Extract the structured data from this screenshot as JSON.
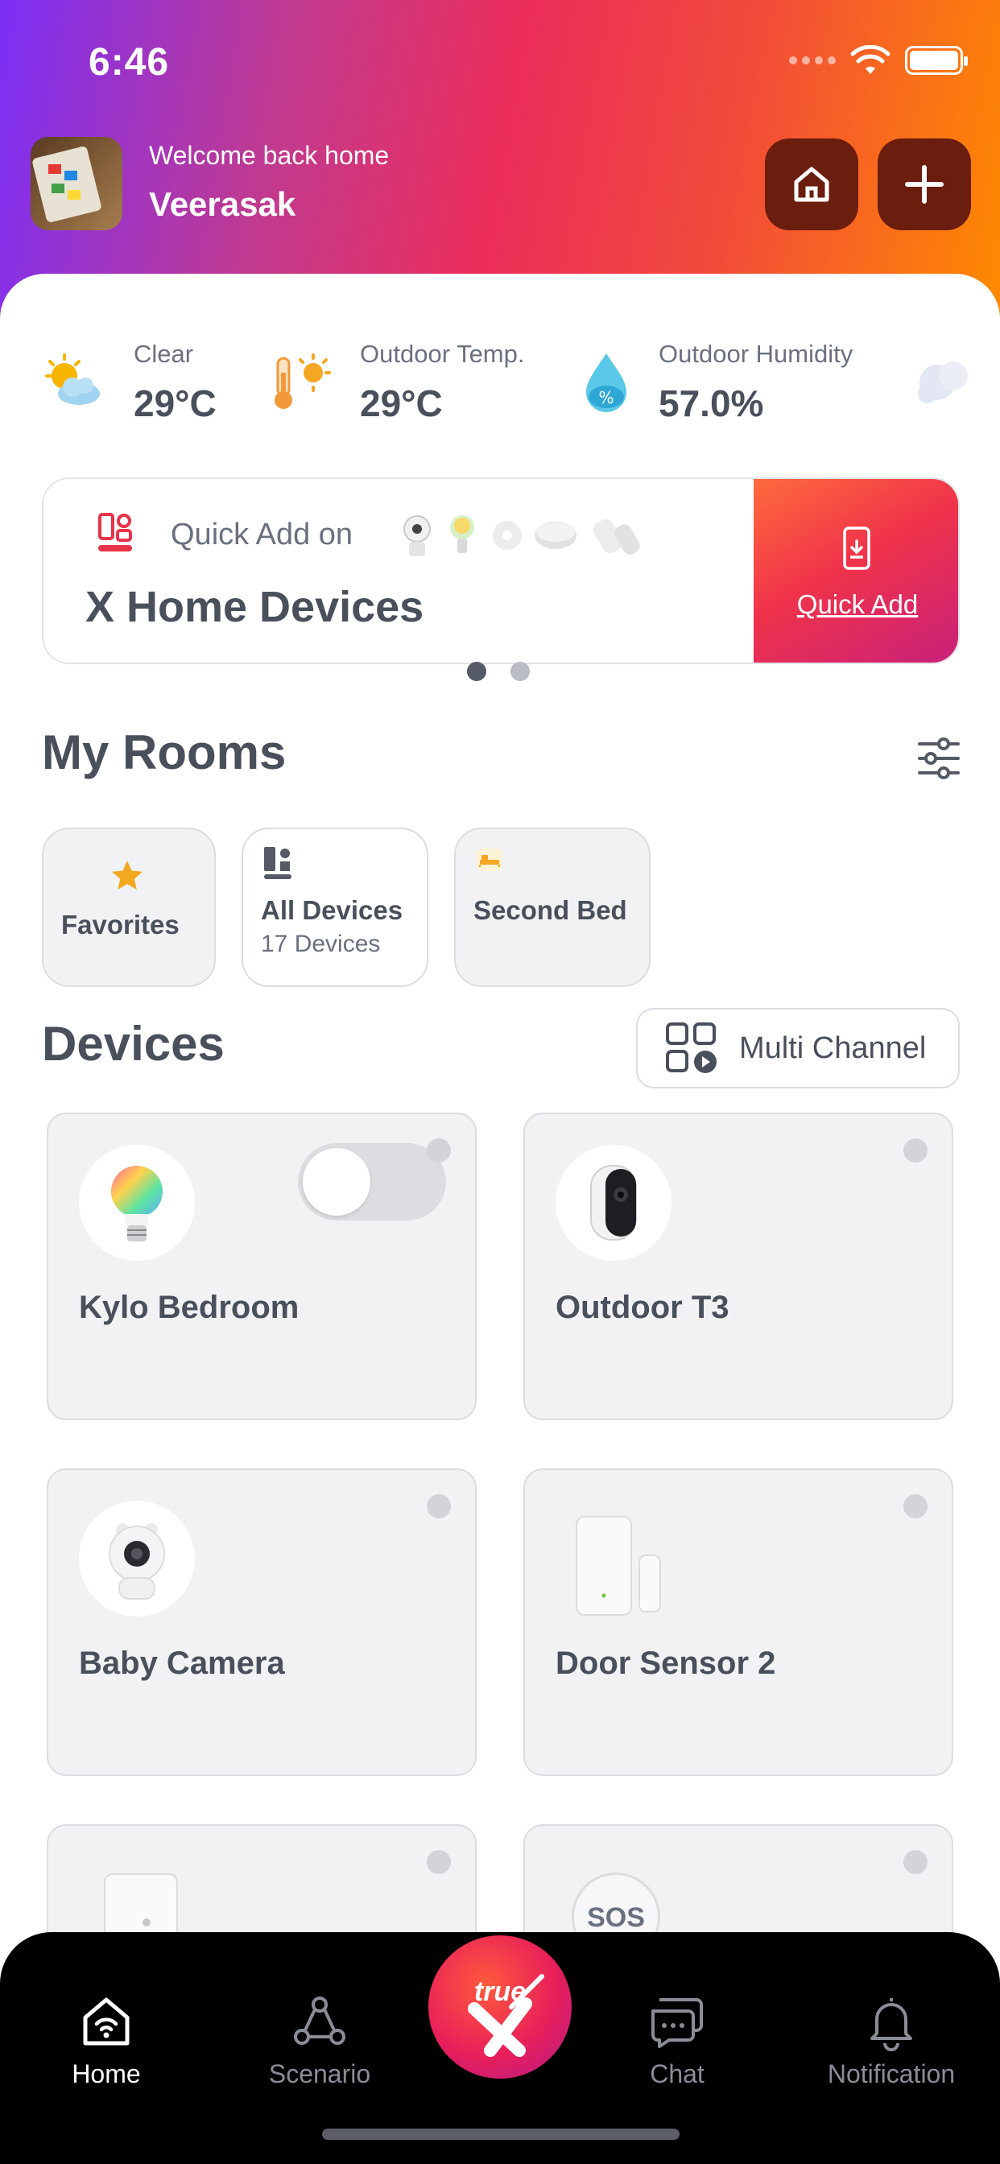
{
  "status_bar": {
    "time": "6:46"
  },
  "header": {
    "welcome": "Welcome back home",
    "username": "Veerasak",
    "icons": [
      "home-icon",
      "plus-icon"
    ]
  },
  "weather": [
    {
      "label": "Clear",
      "value": "29°C",
      "icon": "partly-sunny-icon"
    },
    {
      "label": "Outdoor Temp.",
      "value": "29°C",
      "icon": "thermometer-sun-icon"
    },
    {
      "label": "Outdoor Humidity",
      "value": "57.0%",
      "icon": "humidity-drop-icon"
    }
  ],
  "quick_add": {
    "subtitle": "Quick Add on",
    "title": "X Home Devices",
    "button_label": "Quick Add",
    "page_count": 2,
    "active_page": 1
  },
  "rooms": {
    "title": "My Rooms",
    "items": [
      {
        "name": "Favorites",
        "icon": "star-icon"
      },
      {
        "name": "All Devices",
        "sub": "17 Devices",
        "icon": "devices-icon"
      },
      {
        "name": "Second Bed",
        "icon": "bed-icon"
      }
    ]
  },
  "devices": {
    "title": "Devices",
    "multi_channel_label": "Multi Channel",
    "items": [
      {
        "name": "Kylo Bedroom",
        "icon": "smart-bulb-icon",
        "toggle": "off"
      },
      {
        "name": "Outdoor T3",
        "icon": "outdoor-camera-icon"
      },
      {
        "name": "Baby Camera",
        "icon": "baby-camera-icon"
      },
      {
        "name": "Door Sensor 2",
        "icon": "door-sensor-icon"
      },
      {
        "name": "",
        "icon": "motion-sensor-icon"
      },
      {
        "name": "",
        "icon": "sos-button-icon",
        "badge": "SOS"
      }
    ]
  },
  "tabbar": {
    "tabs": [
      {
        "label": "Home",
        "icon": "home-wifi-icon",
        "active": true
      },
      {
        "label": "Scenario",
        "icon": "scenario-icon"
      },
      {
        "label": "Chat",
        "icon": "chat-icon"
      },
      {
        "label": "Notification",
        "icon": "bell-icon"
      }
    ],
    "center_logo": "true"
  },
  "colors": {
    "gradient_start": "#7b2ff7",
    "gradient_end": "#ff8a00",
    "header_button": "#6b1d0e",
    "text": "#4a4f5c",
    "card_bg": "#f2f2f4",
    "star": "#f2a91f"
  }
}
